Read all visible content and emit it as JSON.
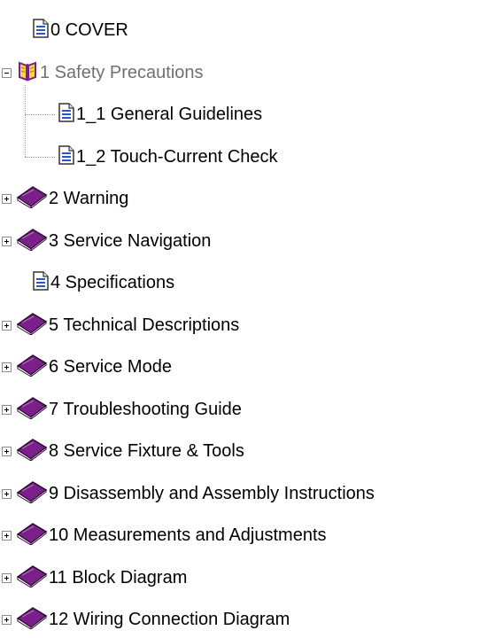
{
  "tree": [
    {
      "id": "cover",
      "label": "0 COVER",
      "icon": "document-icon",
      "toggle": null,
      "depth": 1
    },
    {
      "id": "safety",
      "label": "1 Safety Precautions",
      "icon": "open-book-icon",
      "toggle": "minus",
      "depth": 0,
      "expanded": true
    },
    {
      "id": "general-guidelines",
      "label": "1_1 General Guidelines",
      "icon": "document-icon",
      "toggle": null,
      "depth": 2
    },
    {
      "id": "touch-current",
      "label": "1_2 Touch-Current Check",
      "icon": "document-icon",
      "toggle": null,
      "depth": 2
    },
    {
      "id": "warning",
      "label": "2 Warning",
      "icon": "closed-book-icon",
      "toggle": "plus",
      "depth": 0
    },
    {
      "id": "service-navigation",
      "label": "3 Service Navigation",
      "icon": "closed-book-icon",
      "toggle": "plus",
      "depth": 0
    },
    {
      "id": "specifications",
      "label": "4 Specifications",
      "icon": "document-icon",
      "toggle": null,
      "depth": 1
    },
    {
      "id": "technical-descriptions",
      "label": "5 Technical Descriptions",
      "icon": "closed-book-icon",
      "toggle": "plus",
      "depth": 0
    },
    {
      "id": "service-mode",
      "label": "6 Service Mode",
      "icon": "closed-book-icon",
      "toggle": "plus",
      "depth": 0
    },
    {
      "id": "troubleshooting",
      "label": "7 Troubleshooting Guide",
      "icon": "closed-book-icon",
      "toggle": "plus",
      "depth": 0
    },
    {
      "id": "fixture-tools",
      "label": "8 Service Fixture & Tools",
      "icon": "closed-book-icon",
      "toggle": "plus",
      "depth": 0
    },
    {
      "id": "disassembly",
      "label": "9 Disassembly and Assembly Instructions",
      "icon": "closed-book-icon",
      "toggle": "plus",
      "depth": 0
    },
    {
      "id": "measurements",
      "label": "10 Measurements and Adjustments",
      "icon": "closed-book-icon",
      "toggle": "plus",
      "depth": 0
    },
    {
      "id": "block-diagram",
      "label": "11 Block Diagram",
      "icon": "closed-book-icon",
      "toggle": "plus",
      "depth": 0
    },
    {
      "id": "wiring",
      "label": "12 Wiring Connection Diagram",
      "icon": "closed-book-icon",
      "toggle": "plus",
      "depth": 0
    }
  ],
  "colors": {
    "text": "#000000",
    "expanded_text": "#707070",
    "book_purple": "#7b1f8a",
    "open_book_yellow": "#f4d64a",
    "doc_blue": "#2b56c9"
  }
}
